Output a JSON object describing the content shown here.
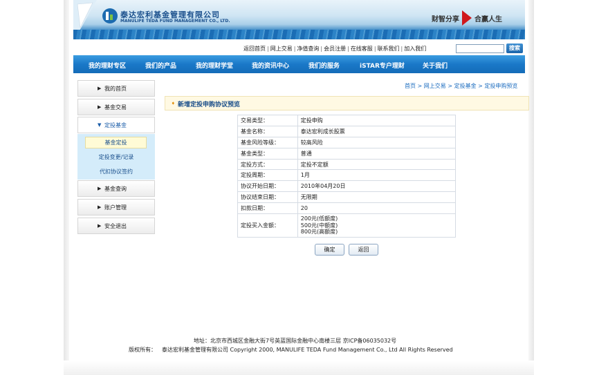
{
  "banner": {
    "company_cn": "泰达宏利基金管理有限公司",
    "company_en": "MANULIFE TEDA FUND MANAGEMENT CO., LTD.",
    "slogan_left": "财智分享",
    "slogan_right": "合赢人生",
    "accent_color": "#d0171b"
  },
  "toplinks": {
    "items": [
      "返回首页",
      "网上交易",
      "净值查询",
      "会员注册",
      "在线客服",
      "联系我们",
      "加入我们"
    ],
    "separator": "|",
    "search_value": "",
    "search_button": "搜索"
  },
  "nav": {
    "items": [
      "我的理财专区",
      "我们的产品",
      "我的理财学堂",
      "我的资讯中心",
      "我们的服务",
      "iSTAR专户理财",
      "关于我们"
    ],
    "color": "#1a78c8"
  },
  "sidebar": {
    "items": [
      {
        "label": "我的首页",
        "icon": "triangle-right-icon"
      },
      {
        "label": "基金交易",
        "icon": "triangle-right-icon"
      },
      {
        "label": "定投基金",
        "icon": "triangle-down-icon"
      },
      {
        "label": "基金查询",
        "icon": "triangle-right-icon"
      },
      {
        "label": "账户管理",
        "icon": "triangle-right-icon"
      },
      {
        "label": "安全退出",
        "icon": "triangle-right-icon"
      }
    ],
    "sub_items": [
      "基金定投",
      "定投变更/记录",
      "代扣协议签约"
    ]
  },
  "breadcrumb": [
    "首页",
    "网上交易",
    "定投基金",
    "定投申购预览"
  ],
  "breadcrumb_separator": ">",
  "section_title": "新增定投申购协议预览",
  "detail": {
    "rows": [
      {
        "label": "交易类型：",
        "value": "定投申购"
      },
      {
        "label": "基金名称：",
        "value": "泰达宏利成长股票"
      },
      {
        "label": "基金风险等级：",
        "value": "较高风险"
      },
      {
        "label": "基金类型：",
        "value": "普通"
      },
      {
        "label": "定投方式：",
        "value": "定投不定额"
      },
      {
        "label": "定投周期：",
        "value": "1月"
      },
      {
        "label": "协议开始日期：",
        "value": "2010年04月20日"
      },
      {
        "label": "协议结束日期：",
        "value": "无限期"
      },
      {
        "label": "扣款日期：",
        "value": "20"
      }
    ],
    "amount_label": "定投买入金额：",
    "amount_lines": [
      "200元(低额度)",
      "500元(中额度)",
      "800元(高额度)"
    ]
  },
  "buttons": {
    "confirm": "确定",
    "back": "返回"
  },
  "footer": {
    "address": "地址：北京市西城区金融大街7号英蓝国际金融中心南楼三层  京ICP备06035032号",
    "copyright_label": "版权所有：",
    "copyright_text": "泰达宏利基金管理有限公司  Copyright 2000, MANULIFE TEDA Fund Management Co., Ltd All Rights Reserved"
  }
}
